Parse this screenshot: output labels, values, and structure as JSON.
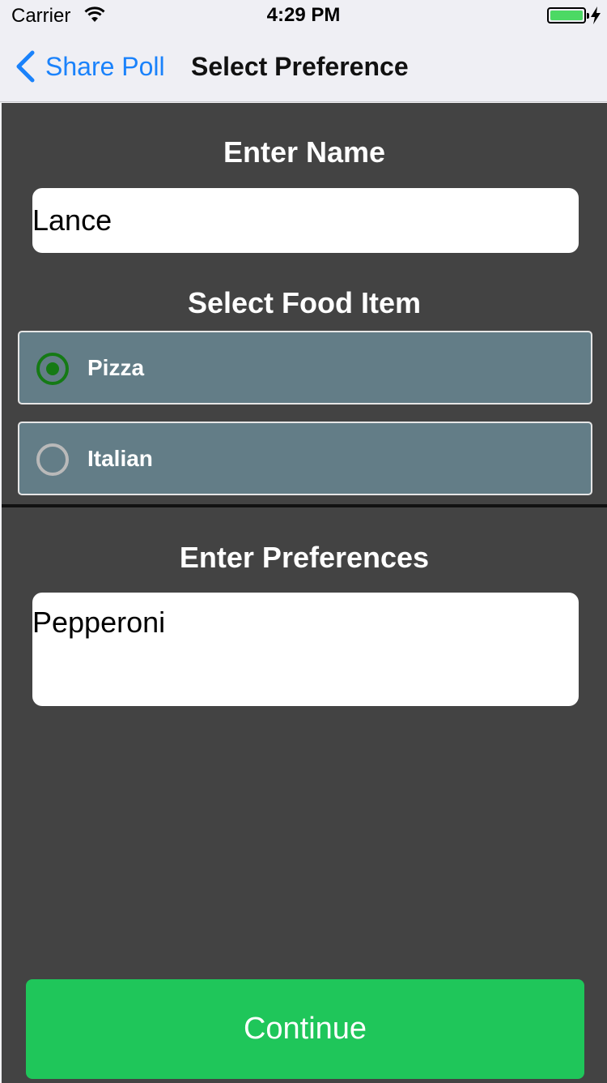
{
  "status_bar": {
    "carrier": "Carrier",
    "time": "4:29 PM",
    "battery_level": 1.0,
    "battery_color": "#4cd964"
  },
  "nav": {
    "back_label": "Share Poll",
    "title": "Select Preference",
    "accent_color": "#1a82fb"
  },
  "name_section": {
    "heading": "Enter Name",
    "value": "Lance"
  },
  "food_section": {
    "heading": "Select Food Item",
    "options": [
      {
        "label": "Pizza",
        "selected": true
      },
      {
        "label": "Italian",
        "selected": false
      }
    ]
  },
  "prefs_section": {
    "heading": "Enter Preferences",
    "value": "Pepperoni"
  },
  "continue_label": "Continue",
  "colors": {
    "background": "#434343",
    "option_background": "#637d87",
    "radio_selected": "#157a15",
    "continue_button": "#1fc65a"
  },
  "icons": [
    "wifi-icon",
    "battery-icon",
    "charge-icon",
    "chevron-left-icon",
    "radio-selected-icon",
    "radio-unselected-icon"
  ]
}
